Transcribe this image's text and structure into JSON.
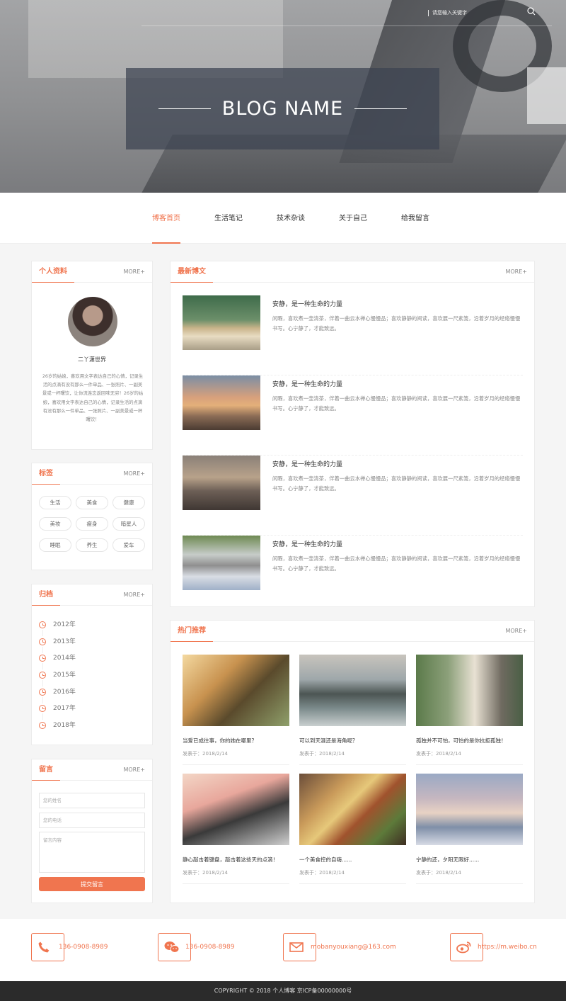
{
  "header": {
    "search_placeholder": "请您输入关键字",
    "brand": "BLOG NAME"
  },
  "nav": {
    "items": [
      {
        "label": "博客首页",
        "active": true
      },
      {
        "label": "生活笔记",
        "active": false
      },
      {
        "label": "技术杂谈",
        "active": false
      },
      {
        "label": "关于自己",
        "active": false
      },
      {
        "label": "给我留言",
        "active": false
      }
    ]
  },
  "profile": {
    "title": "个人资料",
    "more": "MORE+",
    "name": "二丫潇世界",
    "desc": "26岁的姑娘，喜欢用文字表达自己的心情，记录生活的点滴有没有那么一件单品、一张照片、一副美景或一杯曙饮，让你流连忘返回味无穷！26岁的姑娘，喜欢用文字表达自己的心情，记录生活的点滴有没有那么一件单品、一张照片、一副美景或一杯曙饮！"
  },
  "tags": {
    "title": "标签",
    "more": "MORE+",
    "items": [
      "生活",
      "美食",
      "健康",
      "美妆",
      "瘦身",
      "暗星人",
      "睡眠",
      "养生",
      "爱车"
    ]
  },
  "archive": {
    "title": "归档",
    "more": "MORE+",
    "years": [
      "2012年",
      "2013年",
      "2014年",
      "2015年",
      "2016年",
      "2017年",
      "2018年"
    ]
  },
  "message": {
    "title": "留言",
    "more": "MORE+",
    "name_placeholder": "您的姓名",
    "phone_placeholder": "您的电话",
    "content_placeholder": "留言内容",
    "submit": "提交留言"
  },
  "latest": {
    "title": "最新博文",
    "more": "MORE+",
    "posts": [
      {
        "title": "安静，是一种生命的力量",
        "excerpt": "闲暇，喜欢煮一壶清茶，伴着一曲云水禅心慢慢品；喜欢静静的阅读，喜欢展一尺素笺，沿着岁月的经络慢慢书写。心宁静了，才能致远。"
      },
      {
        "title": "安静，是一种生命的力量",
        "excerpt": "闲暇，喜欢煮一壶清茶，伴着一曲云水禅心慢慢品；喜欢静静的阅读，喜欢展一尺素笺，沿着岁月的经络慢慢书写。心宁静了，才能致远。"
      },
      {
        "title": "安静，是一种生命的力量",
        "excerpt": "闲暇，喜欢煮一壶清茶，伴着一曲云水禅心慢慢品；喜欢静静的阅读，喜欢展一尺素笺，沿着岁月的经络慢慢书写。心宁静了，才能致远。"
      },
      {
        "title": "安静，是一种生命的力量",
        "excerpt": "闲暇，喜欢煮一壶清茶，伴着一曲云水禅心慢慢品；喜欢静静的阅读，喜欢展一尺素笺，沿着岁月的经络慢慢书写。心宁静了，才能致远。"
      }
    ]
  },
  "hot": {
    "title": "热门推荐",
    "more": "MORE+",
    "items": [
      {
        "caption": "当爱已成往事，你的她在哪里？",
        "date": "发表于：2018/2/14"
      },
      {
        "caption": "可以到天涯还是海角呢？",
        "date": "发表于：2018/2/14"
      },
      {
        "caption": "孤独并不可怕，可怕的是你抗拒孤独！",
        "date": "发表于：2018/2/14"
      },
      {
        "caption": "静心敲击着键盘，敲击着这些天的点滴！",
        "date": "发表于：2018/2/14"
      },
      {
        "caption": "一个美食控的自嗨......",
        "date": "发表于：2018/2/14"
      },
      {
        "caption": "宁静的还，夕阳无限好......",
        "date": "发表于：2018/2/14"
      }
    ]
  },
  "footer": {
    "phone": "136-0908-8989",
    "wechat": "136-0908-8989",
    "email": "mobanyouxiang@163.com",
    "weibo": "https://m.weibo.cn",
    "copyright": "COPYRIGHT © 2018 个人博客 京ICP备00000000号"
  },
  "colors": {
    "accent": "#f0754f",
    "footer_bg": "#2b2b2b"
  }
}
